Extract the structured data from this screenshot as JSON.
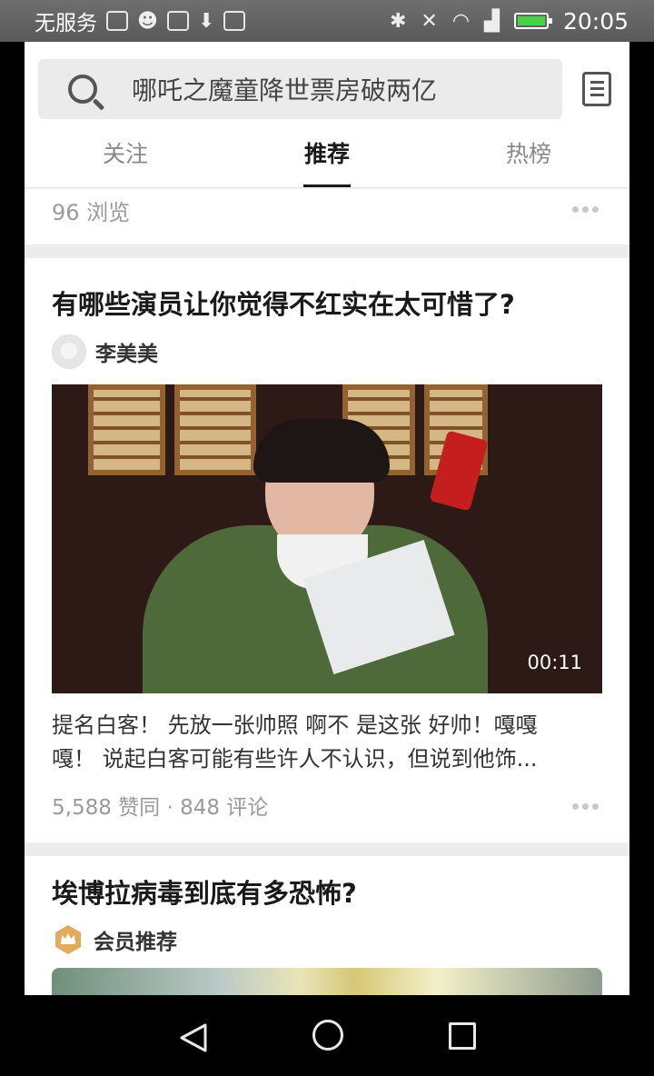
{
  "status_bar": {
    "carrier": "无服务",
    "time": "20:05",
    "battery_color": "#46d146"
  },
  "search": {
    "text": "哪吒之魔童降世票房破两亿"
  },
  "tabs": [
    {
      "label": "关注",
      "active": false
    },
    {
      "label": "推荐",
      "active": true
    },
    {
      "label": "热榜",
      "active": false
    }
  ],
  "feed": {
    "partial_card": {
      "views": "96 浏览"
    },
    "card1": {
      "title": "有哪些演员让你觉得不红实在太可惜了?",
      "author": "李美美",
      "video_duration": "00:11",
      "excerpt_line1": "提名白客！ 先放一张帅照 啊不 是这张 好帅！嘎嘎",
      "excerpt_line2": "嘎！ 说起白客可能有些许人不认识，但说到他饰...",
      "stats": "5,588 赞同 · 848 评论"
    },
    "card2": {
      "title": "埃博拉病毒到底有多恐怖?",
      "author": "会员推荐"
    }
  }
}
